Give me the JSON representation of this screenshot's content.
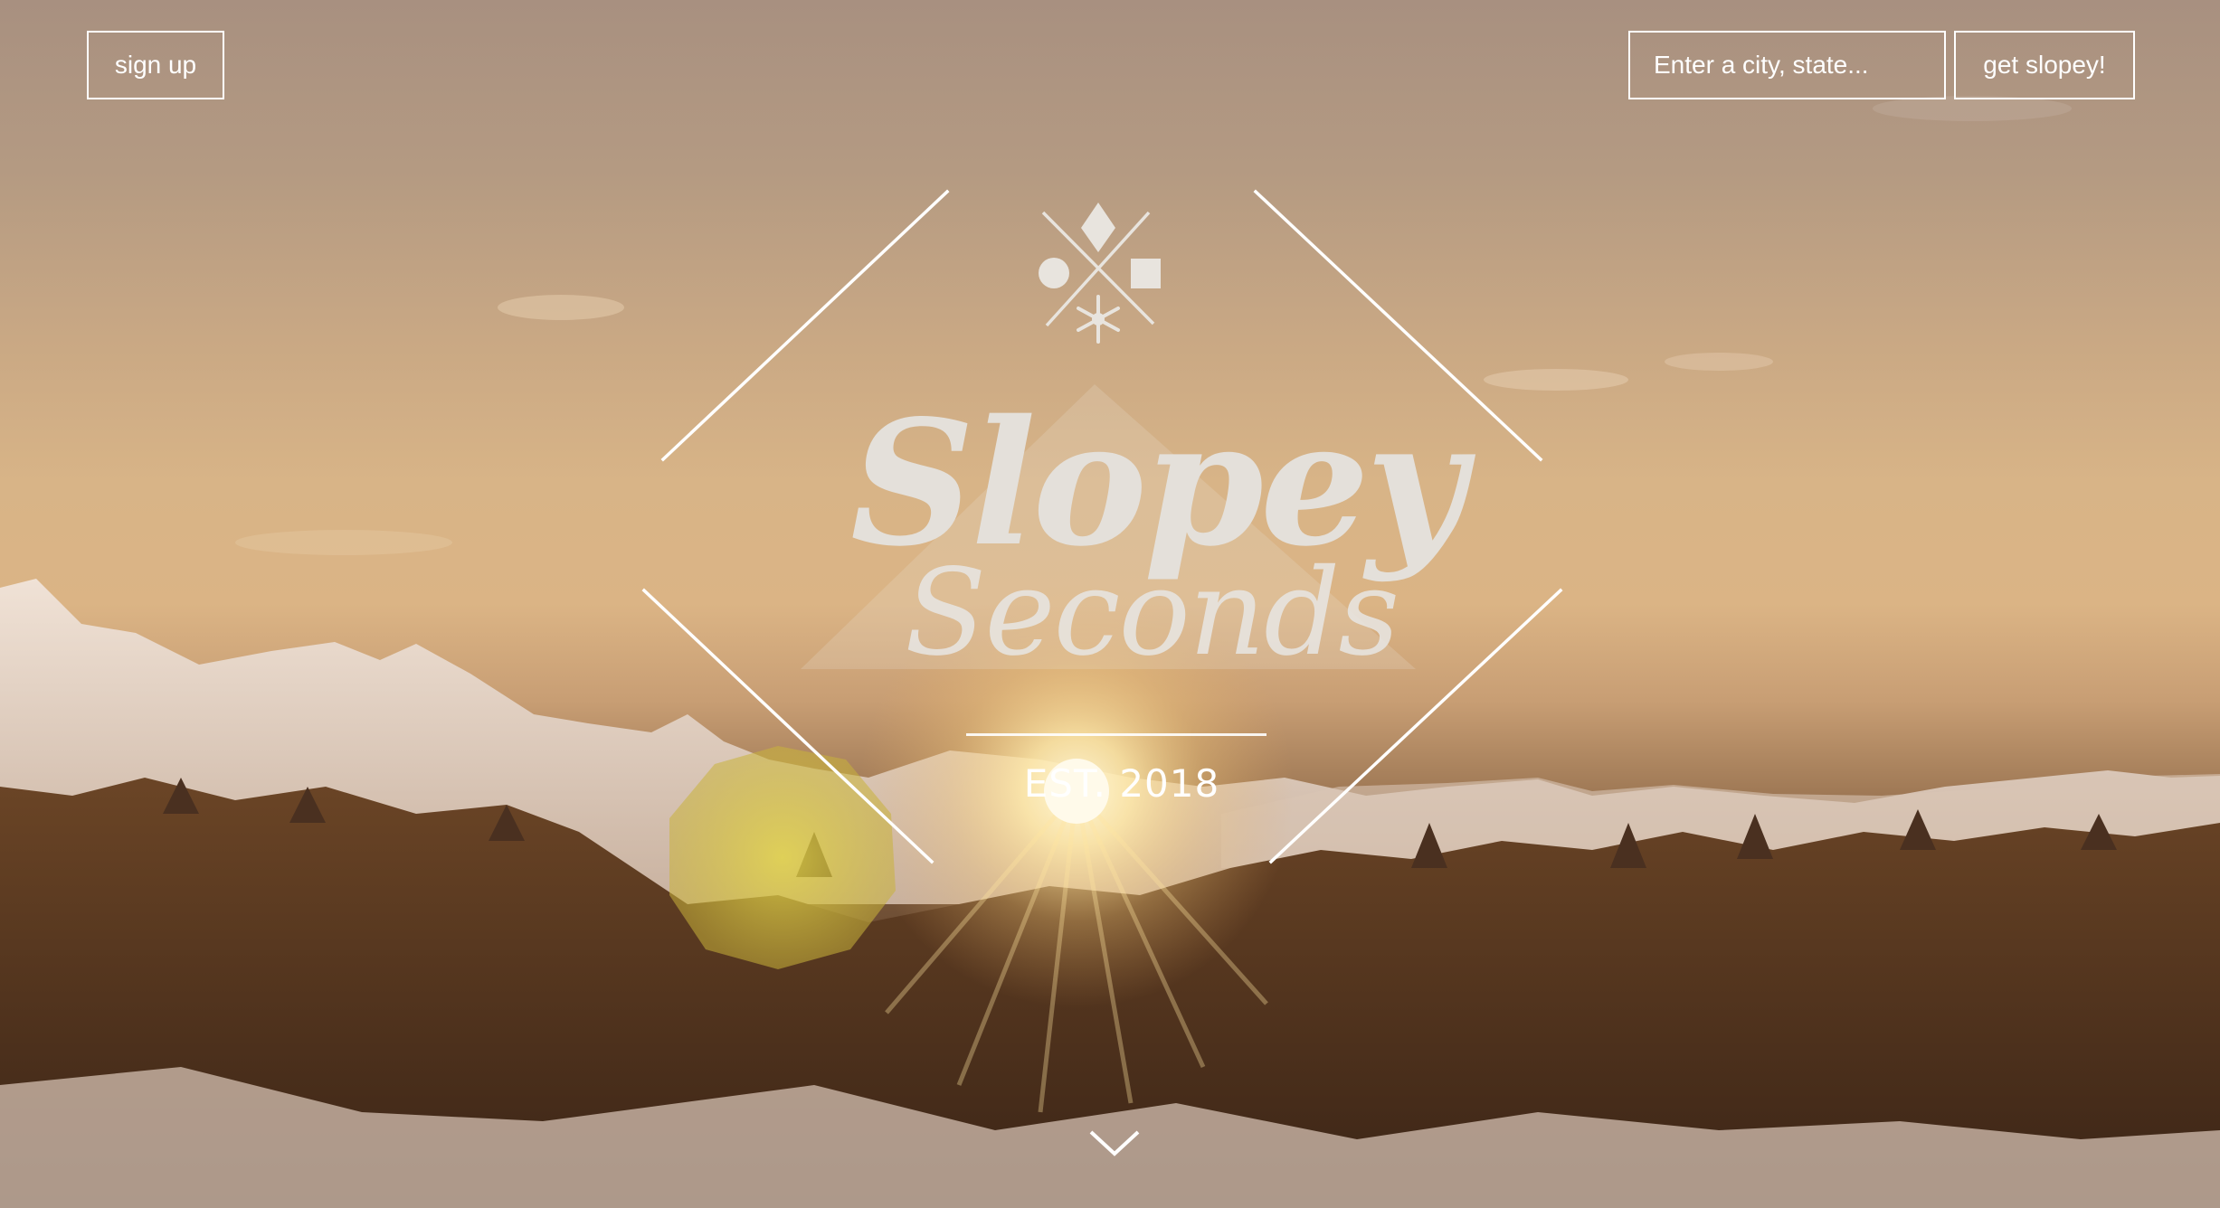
{
  "nav": {
    "signup_label": "sign up",
    "search_placeholder": "Enter a city, state...",
    "submit_label": "get slopey!"
  },
  "logo": {
    "line1": "Slopey",
    "line2": "Seconds",
    "established": "EST. 2018"
  },
  "icons": {
    "emblem": "difficulty-symbols-icon",
    "scroll": "chevron-down-icon"
  },
  "colors": {
    "text": "#ffffff",
    "logo": "#e4e0da"
  }
}
